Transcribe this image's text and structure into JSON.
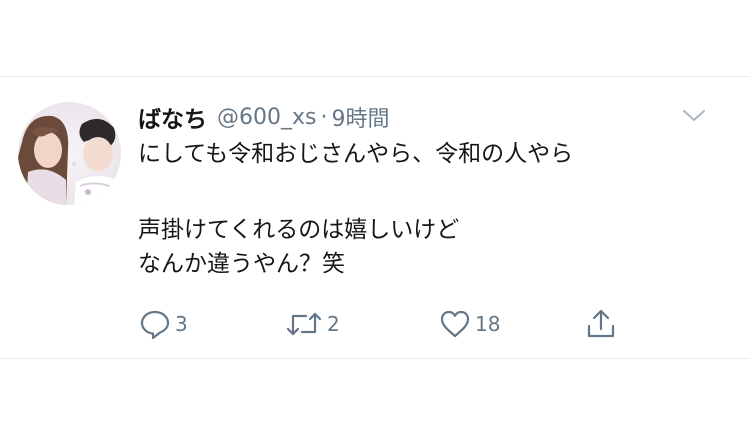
{
  "tweet": {
    "display_name": "ばなち",
    "handle": "@600_xs",
    "separator": "·",
    "timestamp": "9時間",
    "text_lines": [
      "にしても令和おじさんやら、令和の人やら",
      "声掛けてくれるのは嬉しいけど",
      "なんか違うやん？笑"
    ],
    "actions": {
      "reply_count": "3",
      "retweet_count": "2",
      "like_count": "18"
    }
  },
  "icons": {
    "menu": "chevron-down-icon",
    "reply": "reply-icon",
    "retweet": "retweet-icon",
    "like": "heart-icon",
    "share": "share-icon"
  },
  "colors": {
    "text_primary": "#14171a",
    "text_secondary": "#657786",
    "divider": "#e6ecf0",
    "chevron": "#aab8c2"
  }
}
